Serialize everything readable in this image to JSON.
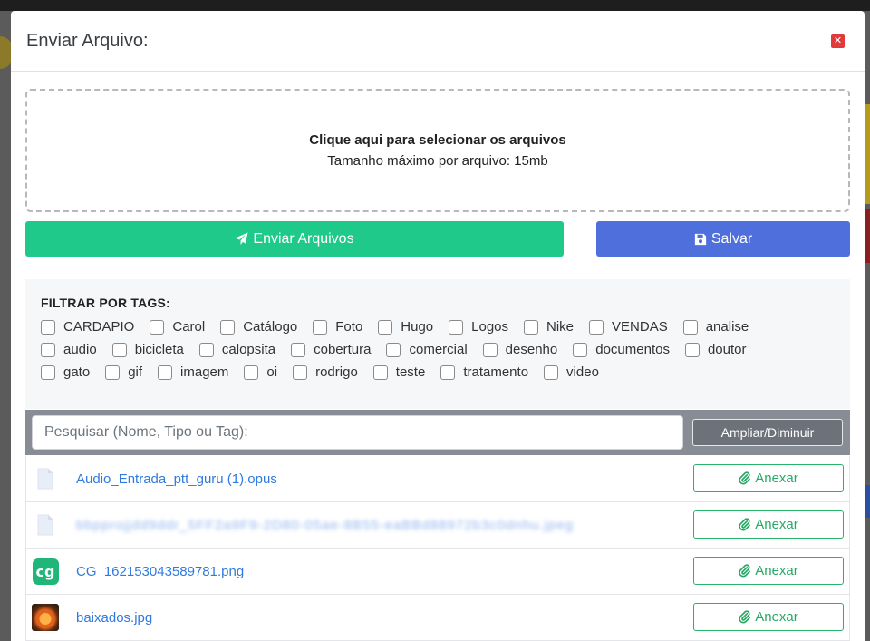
{
  "modal": {
    "title": "Enviar Arquivo:"
  },
  "dropzone": {
    "title": "Clique aqui para selecionar os arquivos",
    "subtitle": "Tamanho máximo por arquivo: 15mb"
  },
  "actions": {
    "send_label": "Enviar Arquivos",
    "save_label": "Salvar"
  },
  "tags": {
    "title": "FILTRAR POR TAGS:",
    "items": [
      "CARDAPIO",
      "Carol",
      "Catálogo",
      "Foto",
      "Hugo",
      "Logos",
      "Nike",
      "VENDAS",
      "analise",
      "audio",
      "bicicleta",
      "calopsita",
      "cobertura",
      "comercial",
      "desenho",
      "documentos",
      "doutor",
      "gato",
      "gif",
      "imagem",
      "oi",
      "rodrigo",
      "teste",
      "tratamento",
      "video"
    ]
  },
  "search": {
    "placeholder": "Pesquisar (Nome, Tipo ou Tag):",
    "zoom_label": "Ampliar/Diminuir"
  },
  "files": [
    {
      "name": "Audio_Entrada_ptt_guru (1).opus",
      "thumb": "file-icon",
      "action": "Anexar"
    },
    {
      "name": "bbpprojjdd9ddr_5FF2a9F9-2D80-05ae-8B55-eaBBd88972b3c0dnhu.jpeg",
      "thumb": "file-icon",
      "action": "Anexar",
      "blurred": true
    },
    {
      "name": "CG_162153043589781.png",
      "thumb": "cg-logo",
      "action": "Anexar"
    },
    {
      "name": "baixados.jpg",
      "thumb": "image-thumbnail",
      "action": "Anexar"
    }
  ],
  "colors": {
    "send": "#1ec98a",
    "save": "#4e6fdc",
    "attach": "#28a865",
    "link": "#2f7ae0",
    "close": "#e03a3a"
  }
}
